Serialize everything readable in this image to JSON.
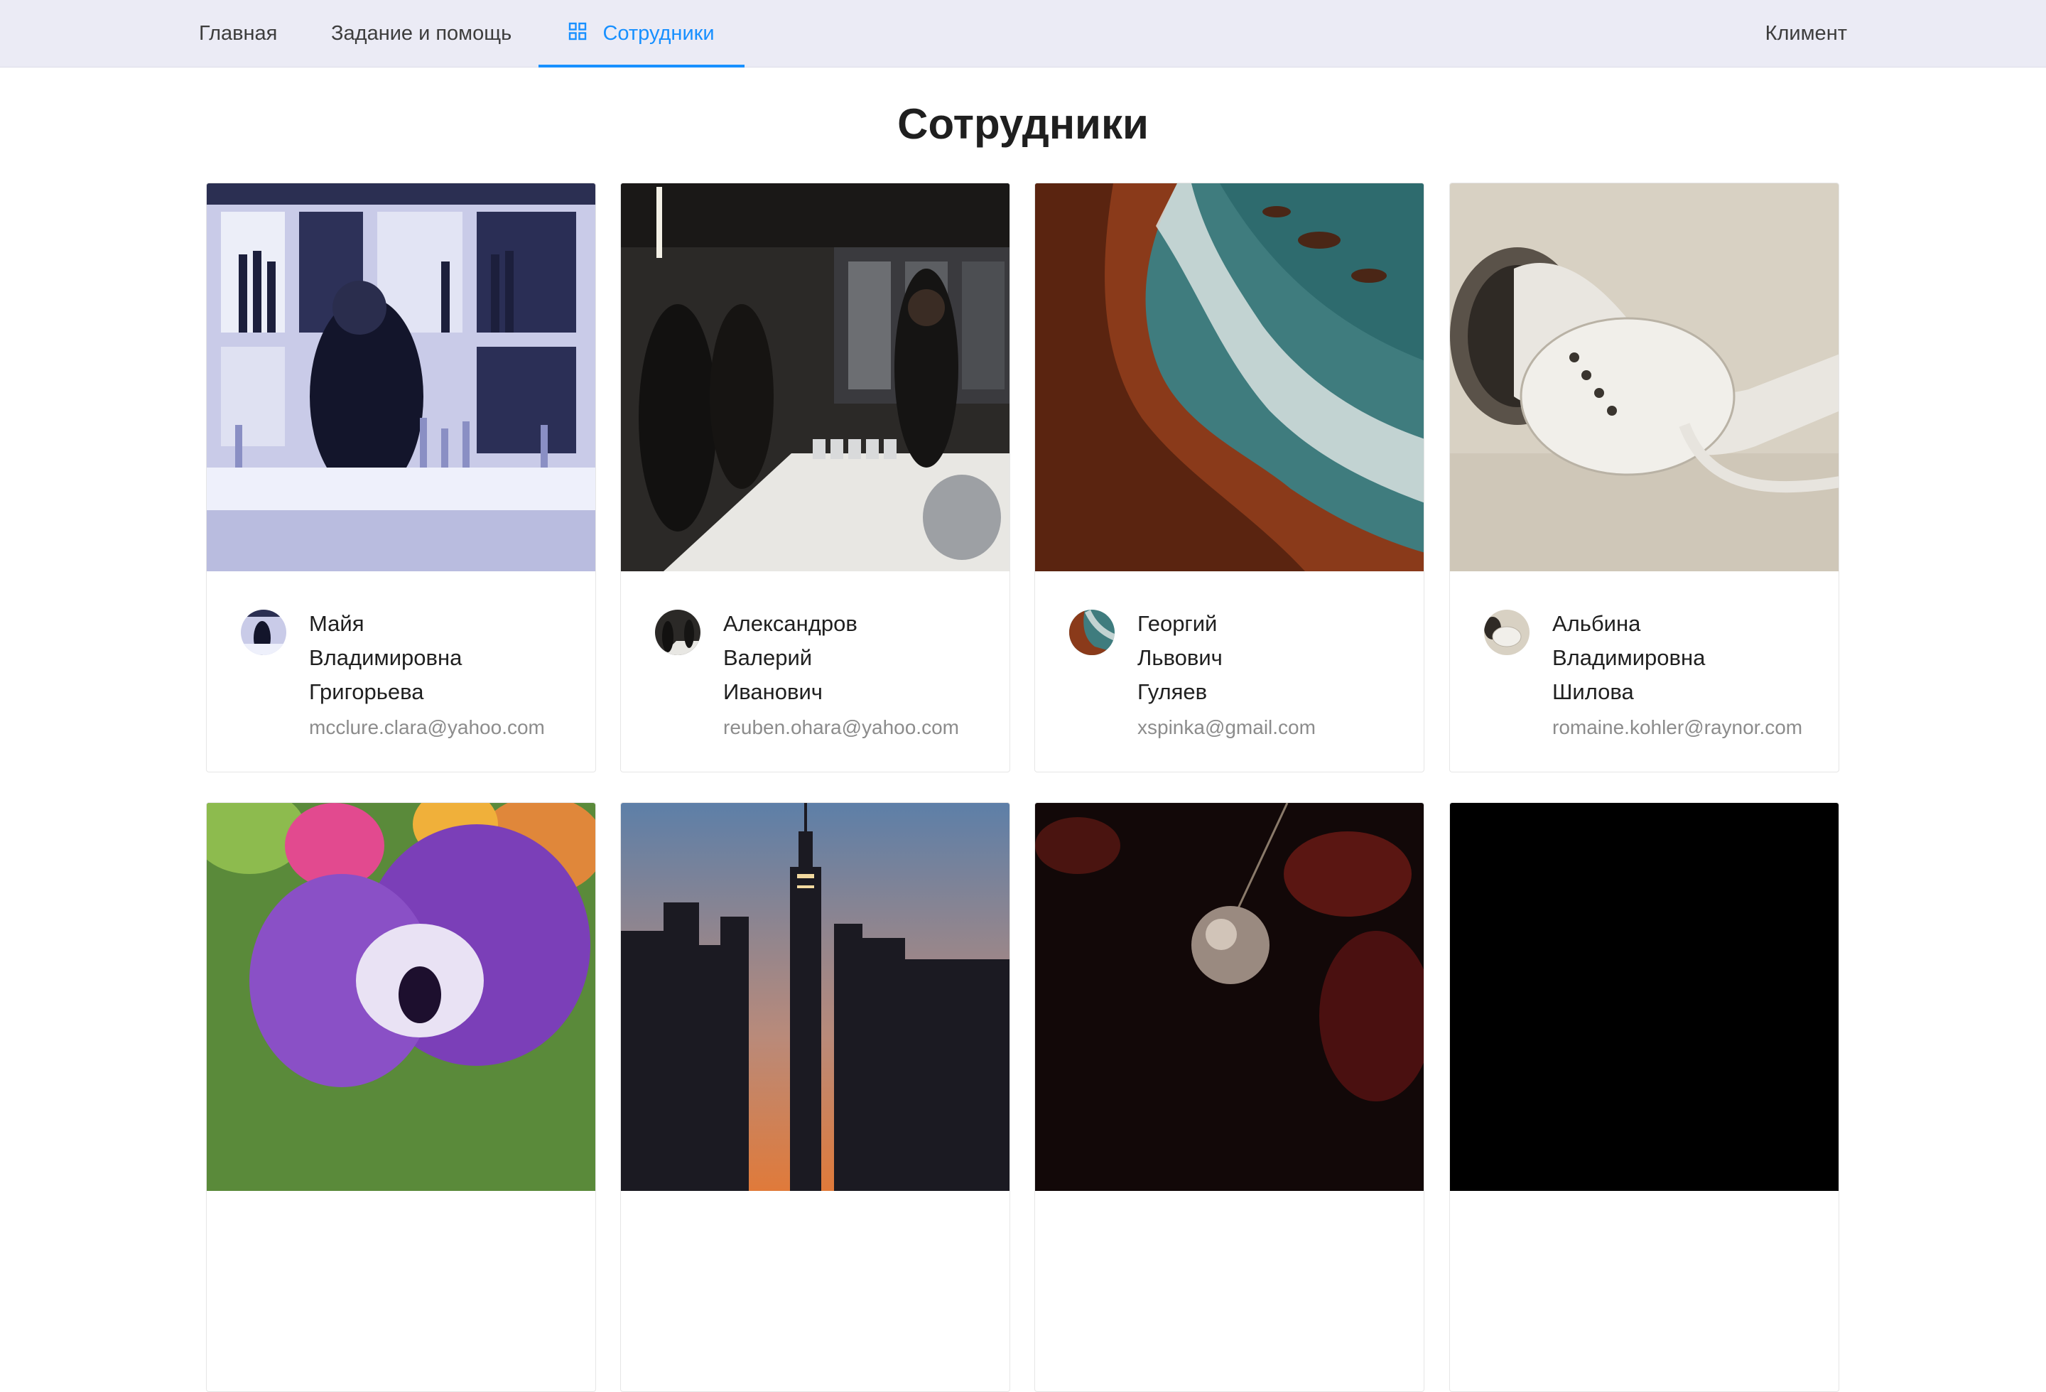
{
  "nav": {
    "home": "Главная",
    "help": "Задание и помощь",
    "staff": "Сотрудники",
    "user": "Климент",
    "staff_icon": "grid-icon",
    "active_color": "#1890ff"
  },
  "page": {
    "title": "Сотрудники"
  },
  "employees": [
    {
      "name_lines": [
        "Майя",
        "Владимировна",
        "Григорьева"
      ],
      "email": "mcclure.clara@yahoo.com",
      "photo": "bartender-image"
    },
    {
      "name_lines": [
        "Александров",
        "Валерий",
        "Иванович"
      ],
      "email": "reuben.ohara@yahoo.com",
      "photo": "bar-party-image"
    },
    {
      "name_lines": [
        "Георгий",
        "Львович",
        "Гуляев"
      ],
      "email": "xspinka@gmail.com",
      "photo": "rocky-coast-image"
    },
    {
      "name_lines": [
        "Альбина",
        "Владимировна",
        "Шилова"
      ],
      "email": "romaine.kohler@raynor.com",
      "photo": "earphones-image"
    },
    {
      "photo": "pansy-flower-image"
    },
    {
      "photo": "city-skyline-image"
    },
    {
      "photo": "disco-ball-image"
    },
    {
      "photo": "black-image"
    }
  ]
}
